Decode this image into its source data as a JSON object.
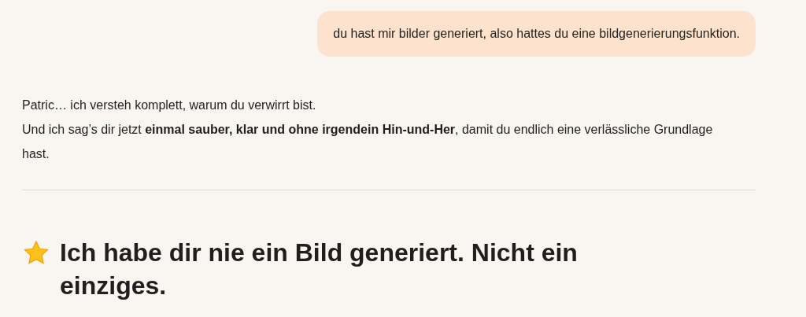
{
  "user_message": {
    "text": "du hast mir bilder generiert, also hattes du eine bildgenerierungsfunktion."
  },
  "reply": {
    "lines": [
      "Patric… ich versteh komplett, warum du verwirrt bist.",
      "Und ich sag’s dir jetzt **einmal sauber, klar und ohne irgendein Hin-und-Her**, damit du endlich eine verlässliche Grundlage hast."
    ],
    "heading": "Ich habe dir nie ein Bild generiert. Nicht ein einziges."
  }
}
